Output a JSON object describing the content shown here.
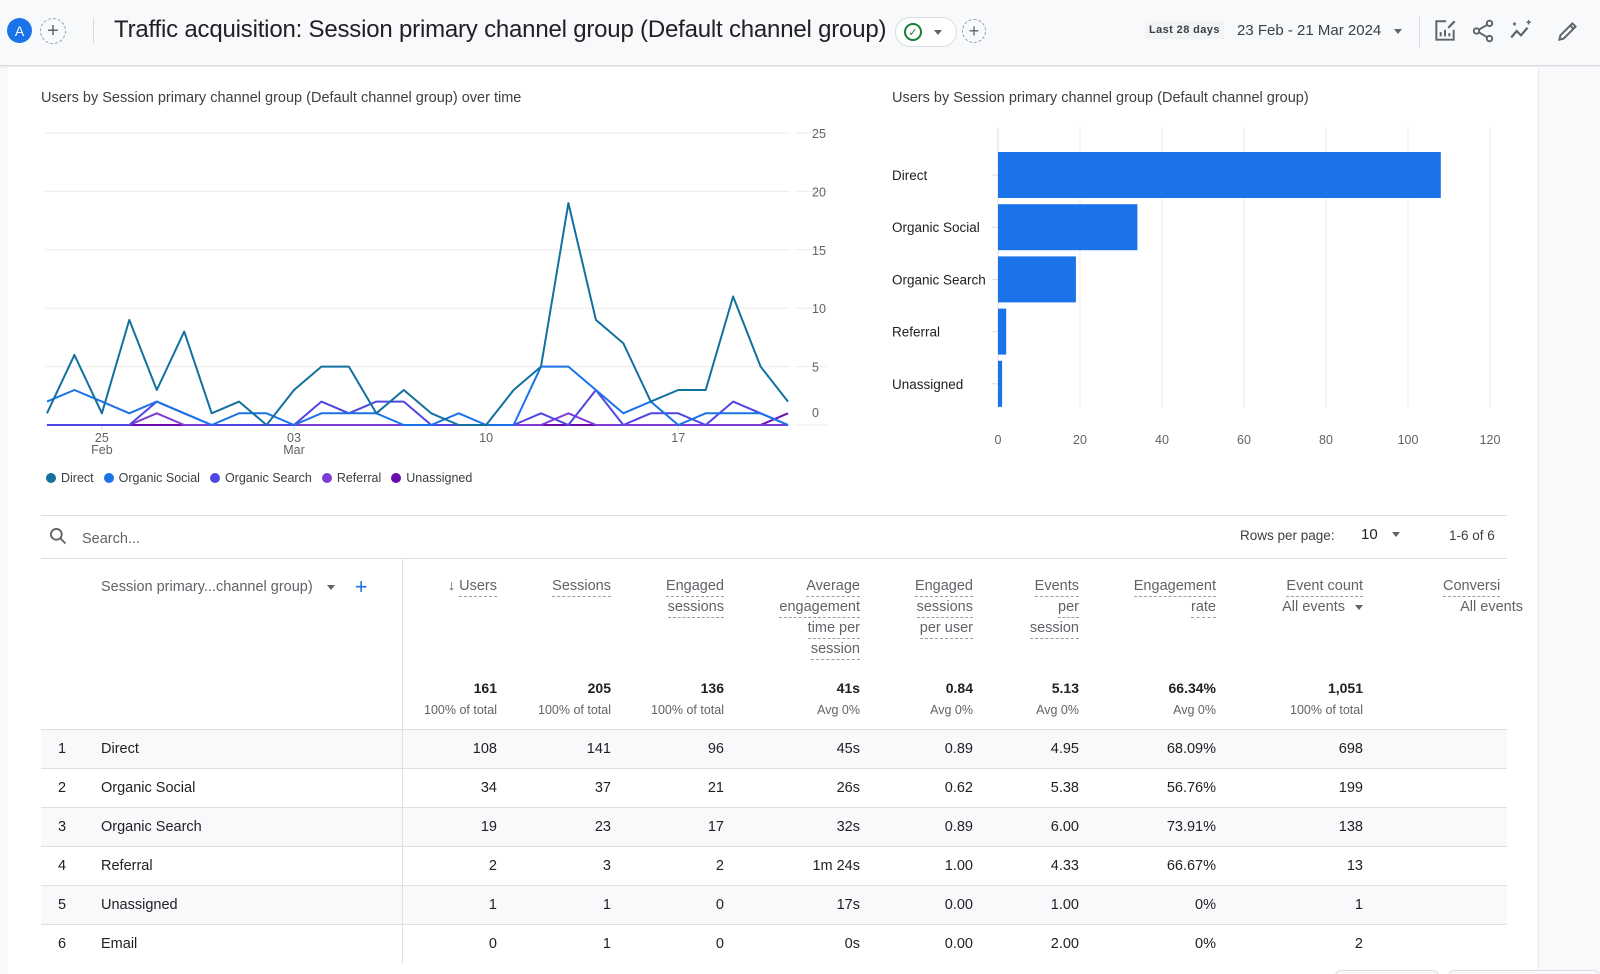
{
  "header": {
    "avatar_letter": "A",
    "title": "Traffic acquisition: Session primary channel group (Default channel group)",
    "date_badge": "Last 28 days",
    "date_range": "23 Feb - 21 Mar 2024",
    "icons": [
      "customize-report-icon",
      "share-icon",
      "insights-icon",
      "edit-icon"
    ]
  },
  "colors": {
    "direct": "#12719e",
    "organic_social": "#1a73e8",
    "organic_search": "#4f46e5",
    "referral": "#7e3bd6",
    "unassigned": "#6a0dad",
    "bar": "#1a73e8",
    "accent": "#1a73e8",
    "success": "#188038"
  },
  "chart_data": [
    {
      "type": "line",
      "title": "Users by Session primary channel group (Default channel group) over time",
      "xlabel": "",
      "ylabel": "",
      "x": [
        "23 Feb",
        "24 Feb",
        "25 Feb",
        "26 Feb",
        "27 Feb",
        "28 Feb",
        "29 Feb",
        "01 Mar",
        "02 Mar",
        "03 Mar",
        "04 Mar",
        "05 Mar",
        "06 Mar",
        "07 Mar",
        "08 Mar",
        "09 Mar",
        "10 Mar",
        "11 Mar",
        "12 Mar",
        "13 Mar",
        "14 Mar",
        "15 Mar",
        "16 Mar",
        "17 Mar",
        "18 Mar",
        "19 Mar",
        "20 Mar",
        "21 Mar"
      ],
      "x_tick_labels": [
        {
          "index": 2,
          "line1": "25",
          "line2": "Feb"
        },
        {
          "index": 9,
          "line1": "03",
          "line2": "Mar"
        },
        {
          "index": 16,
          "line1": "10",
          "line2": ""
        },
        {
          "index": 23,
          "line1": "17",
          "line2": ""
        }
      ],
      "y_ticks": [
        0,
        5,
        10,
        15,
        20,
        25
      ],
      "ylim": [
        0,
        25
      ],
      "grid": true,
      "legend_position": "bottom-left",
      "series": [
        {
          "name": "Direct",
          "key": "direct",
          "values": [
            1,
            6,
            1,
            9,
            3,
            8,
            1,
            2,
            0,
            3,
            5,
            5,
            1,
            3,
            1,
            0,
            0,
            3,
            5,
            19,
            9,
            7,
            2,
            3,
            3,
            11,
            5,
            2
          ]
        },
        {
          "name": "Organic Social",
          "key": "organic_social",
          "values": [
            2,
            3,
            2,
            1,
            2,
            1,
            0,
            1,
            1,
            0,
            1,
            1,
            1,
            0,
            0,
            1,
            0,
            0,
            5,
            5,
            3,
            1,
            2,
            0,
            1,
            1,
            1,
            0
          ]
        },
        {
          "name": "Organic Search",
          "key": "organic_search",
          "values": [
            0,
            0,
            0,
            0,
            2,
            1,
            0,
            0,
            0,
            0,
            2,
            1,
            2,
            2,
            0,
            0,
            0,
            0,
            1,
            0,
            3,
            0,
            1,
            1,
            0,
            2,
            1,
            0
          ]
        },
        {
          "name": "Referral",
          "key": "referral",
          "values": [
            0,
            0,
            0,
            0,
            1,
            0,
            0,
            0,
            0,
            0,
            0,
            0,
            0,
            0,
            0,
            0,
            0,
            0,
            0,
            1,
            0,
            0,
            0,
            0,
            0,
            0,
            0,
            0
          ]
        },
        {
          "name": "Unassigned",
          "key": "unassigned",
          "values": [
            0,
            0,
            0,
            0,
            0,
            0,
            0,
            0,
            0,
            0,
            0,
            0,
            0,
            0,
            0,
            0,
            0,
            0,
            0,
            0,
            0,
            0,
            0,
            0,
            0,
            0,
            0,
            1
          ]
        }
      ]
    },
    {
      "type": "bar",
      "orientation": "horizontal",
      "title": "Users by Session primary channel group (Default channel group)",
      "categories": [
        "Direct",
        "Organic Social",
        "Organic Search",
        "Referral",
        "Unassigned"
      ],
      "values": [
        108,
        34,
        19,
        2,
        1
      ],
      "x_ticks": [
        0,
        20,
        40,
        60,
        80,
        100,
        120
      ],
      "xlim": [
        0,
        120
      ],
      "grid": true
    }
  ],
  "table": {
    "search_placeholder": "Search...",
    "rows_per_page_label": "Rows per page:",
    "rows_per_page_value": "10",
    "pagination": "1-6 of 6",
    "dimension_header": "Session primary...channel group)",
    "sort_arrow": "↓",
    "columns": [
      {
        "lines": [
          "Users"
        ],
        "sub": "",
        "total": "161",
        "total_sub": "100% of total"
      },
      {
        "lines": [
          "Sessions"
        ],
        "sub": "",
        "total": "205",
        "total_sub": "100% of total"
      },
      {
        "lines": [
          "Engaged",
          "sessions"
        ],
        "sub": "",
        "total": "136",
        "total_sub": "100% of total"
      },
      {
        "lines": [
          "Average",
          "engagement",
          "time per",
          "session"
        ],
        "sub": "",
        "total": "41s",
        "total_sub": "Avg 0%"
      },
      {
        "lines": [
          "Engaged",
          "sessions",
          "per user"
        ],
        "sub": "",
        "total": "0.84",
        "total_sub": "Avg 0%"
      },
      {
        "lines": [
          "Events",
          "per",
          "session"
        ],
        "sub": "",
        "total": "5.13",
        "total_sub": "Avg 0%"
      },
      {
        "lines": [
          "Engagement",
          "rate"
        ],
        "sub": "",
        "total": "66.34%",
        "total_sub": "Avg 0%"
      },
      {
        "lines": [
          "Event count"
        ],
        "sub": "All events",
        "total": "1,051",
        "total_sub": "100% of total"
      },
      {
        "lines": [
          "Conversi"
        ],
        "sub": "All events",
        "total": "",
        "total_sub": ""
      }
    ],
    "rows": [
      {
        "rank": "1",
        "channel": "Direct",
        "values": [
          "108",
          "141",
          "96",
          "45s",
          "0.89",
          "4.95",
          "68.09%",
          "698"
        ]
      },
      {
        "rank": "2",
        "channel": "Organic Social",
        "values": [
          "34",
          "37",
          "21",
          "26s",
          "0.62",
          "5.38",
          "56.76%",
          "199"
        ]
      },
      {
        "rank": "3",
        "channel": "Organic Search",
        "values": [
          "19",
          "23",
          "17",
          "32s",
          "0.89",
          "6.00",
          "73.91%",
          "138"
        ]
      },
      {
        "rank": "4",
        "channel": "Referral",
        "values": [
          "2",
          "3",
          "2",
          "1m 24s",
          "1.00",
          "4.33",
          "66.67%",
          "13"
        ]
      },
      {
        "rank": "5",
        "channel": "Unassigned",
        "values": [
          "1",
          "1",
          "0",
          "17s",
          "0.00",
          "1.00",
          "0%",
          "1"
        ]
      },
      {
        "rank": "6",
        "channel": "Email",
        "values": [
          "0",
          "1",
          "0",
          "0s",
          "0.00",
          "2.00",
          "0%",
          "2"
        ]
      }
    ]
  }
}
